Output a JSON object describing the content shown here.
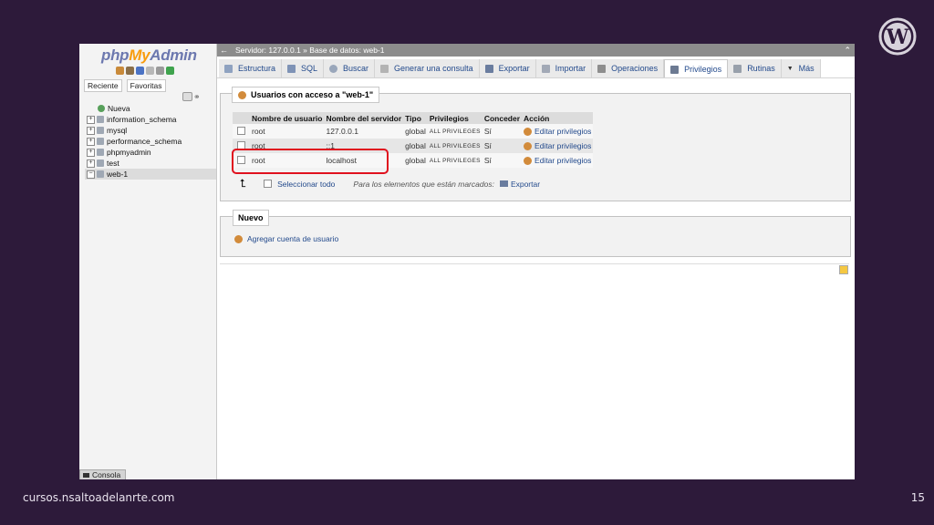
{
  "slide": {
    "footer_url": "cursos.nsaltoadelanrte.com",
    "page_number": "15",
    "logo_icon": "wordpress-logo"
  },
  "sidebar": {
    "logo_php": "php",
    "logo_my": "My",
    "logo_admin": "Admin",
    "tabs": [
      "Reciente",
      "Favoritas"
    ],
    "tree": [
      {
        "label": "Nueva",
        "type": "new"
      },
      {
        "label": "information_schema",
        "type": "db"
      },
      {
        "label": "mysql",
        "type": "db"
      },
      {
        "label": "performance_schema",
        "type": "db"
      },
      {
        "label": "phpmyadmin",
        "type": "db"
      },
      {
        "label": "test",
        "type": "db"
      },
      {
        "label": "web-1",
        "type": "db",
        "selected": true
      }
    ]
  },
  "breadcrumb": {
    "text": "Servidor: 127.0.0.1 » Base de datos: web-1"
  },
  "tabs": [
    {
      "label": "Estructura",
      "icon": "structure-icon"
    },
    {
      "label": "SQL",
      "icon": "sql-icon"
    },
    {
      "label": "Buscar",
      "icon": "search-icon"
    },
    {
      "label": "Generar una consulta",
      "icon": "query-icon"
    },
    {
      "label": "Exportar",
      "icon": "export-icon"
    },
    {
      "label": "Importar",
      "icon": "import-icon"
    },
    {
      "label": "Operaciones",
      "icon": "wrench-icon"
    },
    {
      "label": "Privilegios",
      "icon": "privileges-icon",
      "active": true
    },
    {
      "label": "Rutinas",
      "icon": "routines-icon"
    },
    {
      "label": "Más",
      "icon": "chevron-down-icon"
    }
  ],
  "users_panel": {
    "legend": "Usuarios con acceso a \"web-1\"",
    "headers": [
      "Nombre de usuario",
      "Nombre del servidor",
      "Tipo",
      "Privilegios",
      "Conceder",
      "Acción"
    ],
    "rows": [
      {
        "user": "root",
        "host": "127.0.0.1",
        "type": "global",
        "privileges": "ALL PRIVILEGES",
        "grant": "Sí",
        "action": "Editar privilegios"
      },
      {
        "user": "root",
        "host": "::1",
        "type": "global",
        "privileges": "ALL PRIVILEGES",
        "grant": "Sí",
        "action": "Editar privilegios"
      },
      {
        "user": "root",
        "host": "localhost",
        "type": "global",
        "privileges": "ALL PRIVILEGES",
        "grant": "Sí",
        "action": "Editar privilegios"
      }
    ],
    "select_all": "Seleccionar todo",
    "bulk_note": "Para los elementos que están marcados:",
    "export": "Exportar"
  },
  "new_panel": {
    "legend": "Nuevo",
    "add_user": "Agregar cuenta de usuario"
  },
  "console": {
    "label": "Consola"
  },
  "colors": {
    "slide_bg": "#2d1a3a",
    "highlight": "#e0111e",
    "link": "#234a8c"
  }
}
